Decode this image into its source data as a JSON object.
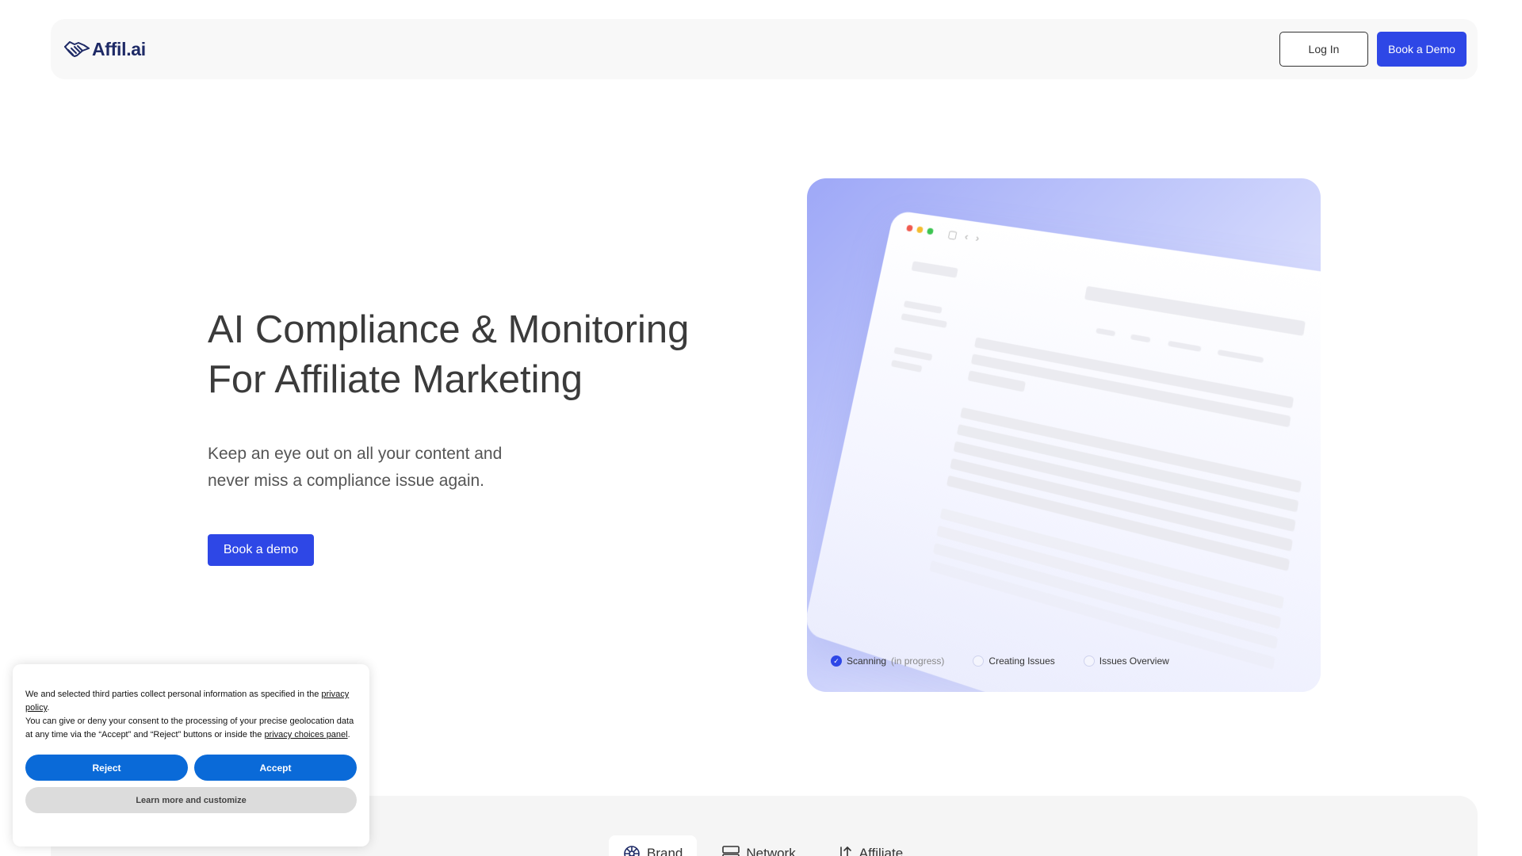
{
  "header": {
    "logo_text": "Affil.ai",
    "login_label": "Log In",
    "book_demo_label": "Book a Demo"
  },
  "hero": {
    "title_line1": "AI Compliance & Monitoring",
    "title_line2": "For Affiliate Marketing",
    "subtitle_line1": "Keep an eye out on all your content and",
    "subtitle_line2": "never miss a compliance issue again.",
    "cta_label": "Book a demo"
  },
  "hero_card": {
    "steps": [
      {
        "label": "Scanning",
        "note": "(in progress)",
        "done": true
      },
      {
        "label": "Creating Issues",
        "note": "",
        "done": false
      },
      {
        "label": "Issues Overview",
        "note": "",
        "done": false
      }
    ]
  },
  "tabs": [
    {
      "label": "Brand",
      "icon": "globe-icon",
      "active": true
    },
    {
      "label": "Network",
      "icon": "server-icon",
      "active": false
    },
    {
      "label": "Affiliate",
      "icon": "sort-arrows-icon",
      "active": false
    }
  ],
  "cookie": {
    "text_1": "We and selected third parties collect personal information as specified in the ",
    "privacy_policy_link": "privacy policy",
    "text_2": ".",
    "text_3": "You can give or deny your consent to the processing of your precise geolocation data at any time via the “Accept” and “Reject” buttons or inside the ",
    "privacy_choices_link": "privacy choices panel",
    "text_4": ".",
    "reject_label": "Reject",
    "accept_label": "Accept",
    "learn_more_label": "Learn more and customize"
  },
  "colors": {
    "brand_blue": "#2e47e6",
    "logo_navy": "#1e2a66",
    "cookie_blue": "#0a6ad8"
  }
}
